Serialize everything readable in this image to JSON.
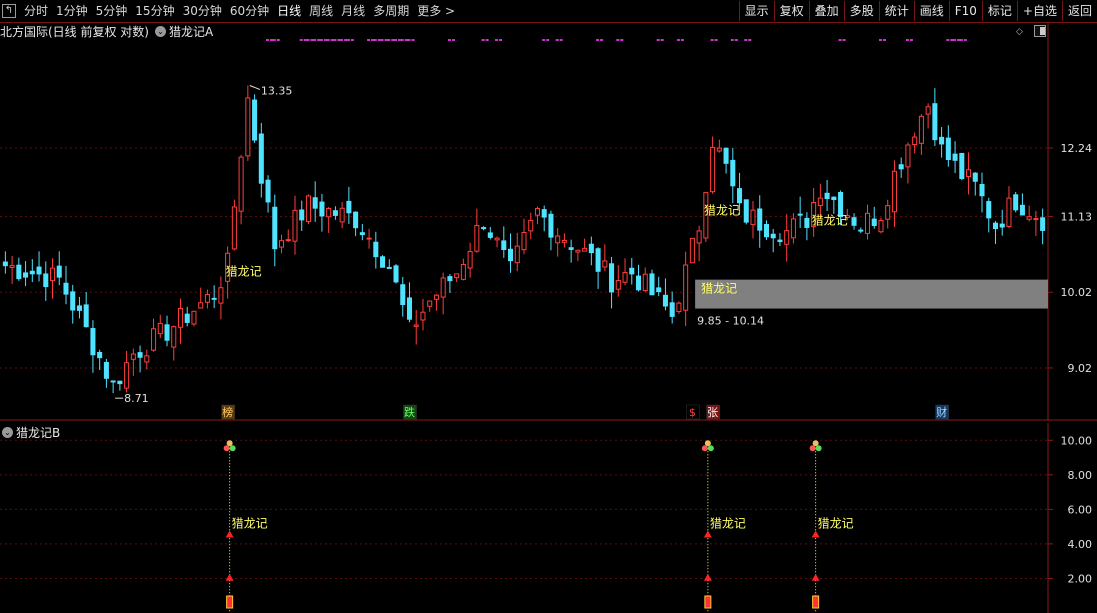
{
  "toolbar": {
    "periods": [
      "分时",
      "1分钟",
      "5分钟",
      "15分钟",
      "30分钟",
      "60分钟",
      "日线",
      "周线",
      "月线",
      "多周期",
      "更多 >"
    ],
    "active": "日线",
    "buttons": [
      "显示",
      "复权",
      "叠加",
      "多股",
      "统计",
      "画线",
      "F10",
      "标记",
      "+自选",
      "返回"
    ]
  },
  "main_title": {
    "stock": "北方国际(日线 前复权 对数)",
    "indicator": "猎龙记A"
  },
  "indicator_title": "猎龙记B",
  "icons": {
    "back": "back-arrow-icon",
    "collapse": "chevron-down-icon",
    "diamond": "diamond-icon",
    "panel": "panel-toggle-icon"
  },
  "colors": {
    "up": "#ff3d3d",
    "down": "#4fe3ff",
    "grid": "#5a0f0f",
    "axis": "#8a1a1a",
    "signal": "#ffff66",
    "magenta": "#cc33cc",
    "label_bg": "#808080"
  },
  "chart_data": [
    {
      "type": "candlestick",
      "title": "北方国际(日线 前复权 对数)",
      "y_scale": "log",
      "ylim": [
        8.45,
        14.2
      ],
      "y_ticks": [
        9.02,
        10.02,
        11.13,
        12.24
      ],
      "n_bars": 155,
      "high_label": "13.35",
      "low_label": "8.71",
      "high_index": 36,
      "low_index": 16,
      "key_points": [
        {
          "i": 0,
          "close": 10.4
        },
        {
          "i": 8,
          "close": 10.2
        },
        {
          "i": 16,
          "close": 8.8
        },
        {
          "i": 19,
          "close": 9.2
        },
        {
          "i": 24,
          "close": 9.5
        },
        {
          "i": 31,
          "close": 10.0
        },
        {
          "i": 33,
          "close": 10.4
        },
        {
          "i": 35,
          "close": 12.2
        },
        {
          "i": 36,
          "close": 13.1
        },
        {
          "i": 38,
          "close": 11.8
        },
        {
          "i": 40,
          "close": 10.7
        },
        {
          "i": 45,
          "close": 11.3
        },
        {
          "i": 52,
          "close": 11.1
        },
        {
          "i": 57,
          "close": 10.4
        },
        {
          "i": 60,
          "close": 9.5
        },
        {
          "i": 63,
          "close": 9.9
        },
        {
          "i": 67,
          "close": 10.3
        },
        {
          "i": 71,
          "close": 11.1
        },
        {
          "i": 75,
          "close": 10.3
        },
        {
          "i": 79,
          "close": 11.2
        },
        {
          "i": 82,
          "close": 10.9
        },
        {
          "i": 87,
          "close": 10.5
        },
        {
          "i": 90,
          "close": 10.2
        },
        {
          "i": 93,
          "close": 10.3
        },
        {
          "i": 96,
          "close": 10.0
        },
        {
          "i": 99,
          "close": 9.7
        },
        {
          "i": 101,
          "close": 10.3
        },
        {
          "i": 103,
          "close": 11.0
        },
        {
          "i": 105,
          "close": 12.4
        },
        {
          "i": 107,
          "close": 11.9
        },
        {
          "i": 109,
          "close": 11.2
        },
        {
          "i": 113,
          "close": 11.0
        },
        {
          "i": 116,
          "close": 10.9
        },
        {
          "i": 119,
          "close": 11.1
        },
        {
          "i": 121,
          "close": 11.6
        },
        {
          "i": 124,
          "close": 11.3
        },
        {
          "i": 127,
          "close": 11.0
        },
        {
          "i": 130,
          "close": 11.2
        },
        {
          "i": 132,
          "close": 11.8
        },
        {
          "i": 135,
          "close": 12.6
        },
        {
          "i": 137,
          "close": 13.0
        },
        {
          "i": 139,
          "close": 12.2
        },
        {
          "i": 142,
          "close": 11.8
        },
        {
          "i": 144,
          "close": 11.6
        },
        {
          "i": 147,
          "close": 11.0
        },
        {
          "i": 150,
          "close": 11.4
        },
        {
          "i": 154,
          "close": 11.1
        }
      ],
      "signal_label": "猎龙记",
      "signals": [
        {
          "i": 33,
          "label": "猎龙记"
        },
        {
          "i": 104,
          "label": "猎龙记"
        },
        {
          "i": 120,
          "label": "猎龙记"
        }
      ],
      "price_zone": {
        "label": "猎龙记",
        "range": "9.85 - 10.14",
        "i_start": 103
      },
      "events": [
        {
          "i": 33,
          "label": "榜",
          "color": "#ffcc66",
          "bg": "#5a3a10"
        },
        {
          "i": 60,
          "label": "跌",
          "color": "#66ff66",
          "bg": "#0f4a0f"
        },
        {
          "i": 102,
          "label": "$",
          "color": "#ff4444",
          "bg": "#000000"
        },
        {
          "i": 105,
          "label": "张",
          "color": "#ffffff",
          "bg": "#7a1515"
        },
        {
          "i": 139,
          "label": "财",
          "color": "#9fd8ff",
          "bg": "#163a66"
        }
      ],
      "magenta_marks": [
        39,
        40,
        44,
        45,
        46,
        47,
        48,
        49,
        50,
        51,
        54,
        55,
        56,
        57,
        58,
        59,
        60,
        66,
        71,
        73,
        80,
        82,
        88,
        91,
        97,
        100,
        105,
        108,
        110,
        124,
        130,
        134,
        140,
        141,
        142
      ]
    },
    {
      "type": "indicator",
      "title": "猎龙记B",
      "ylim": [
        0,
        11
      ],
      "y_ticks": [
        2.0,
        4.0,
        6.0,
        8.0,
        10.0
      ],
      "tick_labels": [
        "2.00",
        "4.00",
        "6.00",
        "8.00",
        "10.00"
      ],
      "signals": [
        {
          "i": 33,
          "label": "猎龙记",
          "value": 10
        },
        {
          "i": 104,
          "label": "猎龙记",
          "value": 10
        },
        {
          "i": 120,
          "label": "猎龙记",
          "value": 10
        }
      ]
    }
  ]
}
